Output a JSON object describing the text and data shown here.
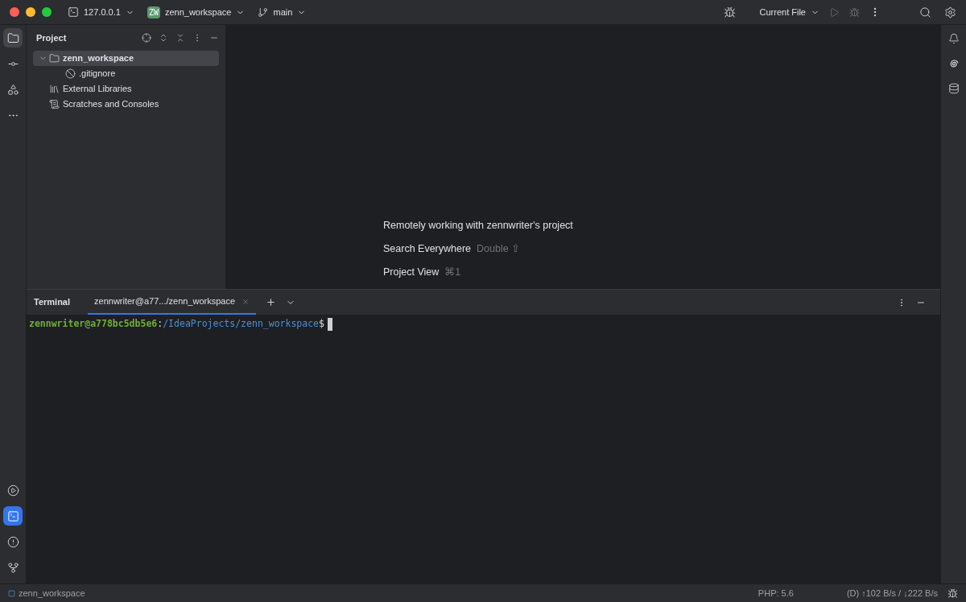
{
  "title_bar": {
    "host": "127.0.0.1",
    "project_badge": "ZW",
    "project": "zenn_workspace",
    "branch": "main",
    "run_config": "Current File"
  },
  "left_toolbar_top": [
    {
      "kind": "folder",
      "selected": true
    },
    {
      "kind": "commit",
      "selected": false
    },
    {
      "kind": "structure",
      "selected": false
    },
    {
      "kind": "more",
      "selected": false
    }
  ],
  "left_toolbar_bottom": [
    {
      "kind": "services",
      "selected": false
    },
    {
      "kind": "terminal",
      "selected": true
    },
    {
      "kind": "problems",
      "selected": false
    },
    {
      "kind": "git",
      "selected": false
    }
  ],
  "project_panel": {
    "title": "Project",
    "tree": [
      {
        "label": "zenn_workspace",
        "kind": "folder",
        "expanded": true,
        "selected": true,
        "children": [
          {
            "label": ".gitignore",
            "kind": "ignored",
            "selected": false
          }
        ]
      },
      {
        "label": "External Libraries",
        "kind": "libraries",
        "selected": false
      },
      {
        "label": "Scratches and Consoles",
        "kind": "scratches",
        "selected": false
      }
    ]
  },
  "editor_hints": [
    {
      "label": "Remotely working with zennwriter's project"
    },
    {
      "label": "Search Everywhere",
      "shortcut": "Double ⇧"
    },
    {
      "label": "Project View",
      "shortcut": "⌘1"
    }
  ],
  "terminal": {
    "title": "Terminal",
    "tabs": [
      {
        "label": "zennwriter@a77.../zenn_workspace",
        "selected": true
      }
    ],
    "prompt": {
      "user_host": "zennwriter@a778bc5db5e6",
      "separator": ":",
      "path": "/IdeaProjects/zenn_workspace",
      "symbol": "$"
    }
  },
  "status_bar": {
    "project": "zenn_workspace",
    "php": "PHP: 5.6",
    "network": "(D) ↑102 B/s / ↓222 B/s"
  }
}
